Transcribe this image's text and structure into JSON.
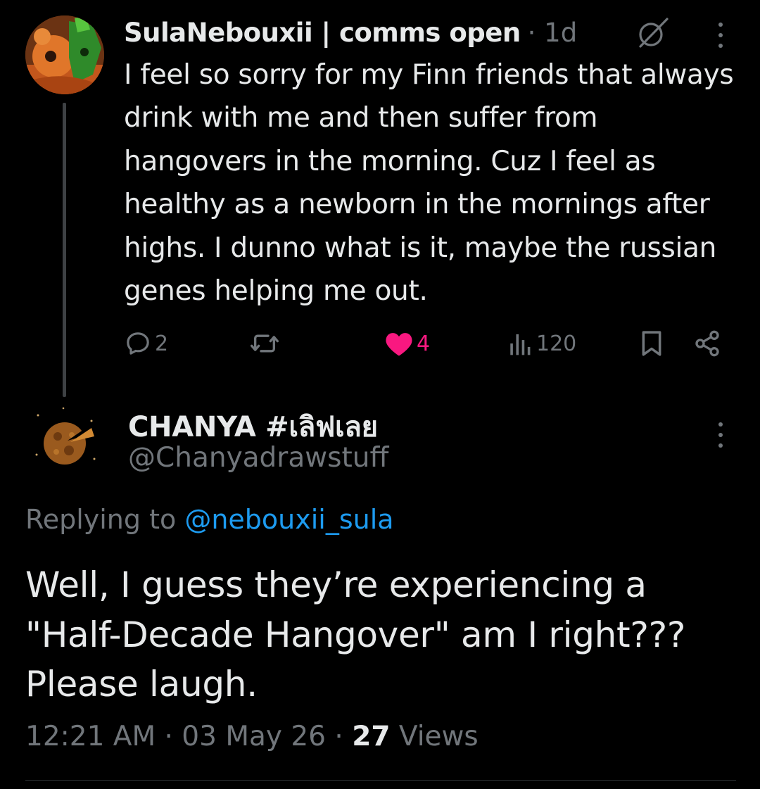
{
  "parent_tweet": {
    "display_name": "SulaNebouxii | comms open",
    "time_ago": "· 1d",
    "text": "I feel so sorry for my Finn friends that always drink with me and then suffer from hangovers in the morning. Cuz I feel as healthy as a newborn in the mornings after highs. I dunno what is it, maybe the russian genes helping me out.",
    "actions": {
      "replies": "2",
      "likes": "4",
      "views": "120"
    },
    "liked": true,
    "like_color": "#f91880"
  },
  "reply_tweet": {
    "display_name": "CHANYA #เลิฟเลย",
    "handle": "@Chanyadrawstuff",
    "replying_prefix": "Replying to ",
    "replying_to": "@nebouxii_sula",
    "text": "Well, I guess they’re experiencing a \"Half-Decade Hangover\" am I right??? Please laugh.",
    "timestamp": "12:21 AM · 03 May 26 · ",
    "views_count": "27",
    "views_label": " Views"
  },
  "colors": {
    "background": "#000000",
    "text_primary": "#e7e9ea",
    "text_secondary": "#71767b",
    "link": "#1d9bf0"
  }
}
